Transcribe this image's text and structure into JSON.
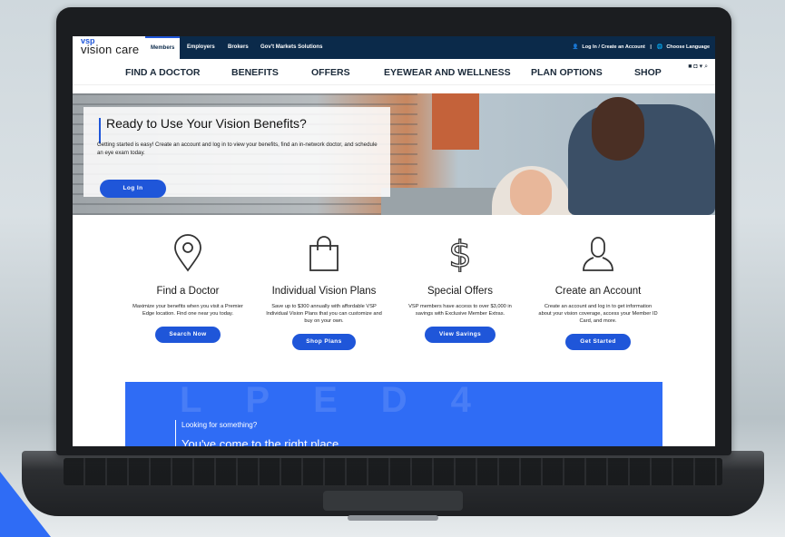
{
  "brand": {
    "vsp": "vsp",
    "name": "vision care",
    "accent": "#1f56d9",
    "navy": "#0b2a4a"
  },
  "audience_tabs": [
    "Members",
    "Employers",
    "Brokers",
    "Gov't Markets Solutions"
  ],
  "top_links": {
    "login": "Log In / Create an Account",
    "language": "Choose Language"
  },
  "main_nav": [
    "FIND A DOCTOR",
    "BENEFITS",
    "OFFERS",
    "EYEWEAR AND WELLNESS",
    "PLAN OPTIONS",
    "SHOP"
  ],
  "social_icons": [
    "facebook-icon",
    "instagram-icon",
    "twitter-icon",
    "search-icon"
  ],
  "hero": {
    "title": "Ready to Use Your Vision Benefits?",
    "text": "Getting started is easy! Create an account and log in to view your benefits, find an in-network doctor, and schedule an eye exam today.",
    "button": "Log In"
  },
  "features": [
    {
      "icon": "location-pin-icon",
      "title": "Find a Doctor",
      "desc": "Maximize your benefits when you visit a Premier Edge location. Find one near you today.",
      "button": "Search Now"
    },
    {
      "icon": "shopping-bag-icon",
      "title": "Individual Vision Plans",
      "desc": "Save up to $300 annually with affordable VSP Individual Vision Plans that you can customize and buy on your own.",
      "button": "Shop Plans"
    },
    {
      "icon": "dollar-sign-icon",
      "title": "Special Offers",
      "desc": "VSP members have access to over $3,000 in savings with Exclusive Member Extras.",
      "button": "View Savings"
    },
    {
      "icon": "user-icon",
      "title": "Create an Account",
      "desc": "Create an account and log in to get information about your vision coverage, access your Member ID Card, and more.",
      "button": "Get Started"
    }
  ],
  "banner": {
    "small": "Looking for something?",
    "big": "You've come to the right place."
  }
}
